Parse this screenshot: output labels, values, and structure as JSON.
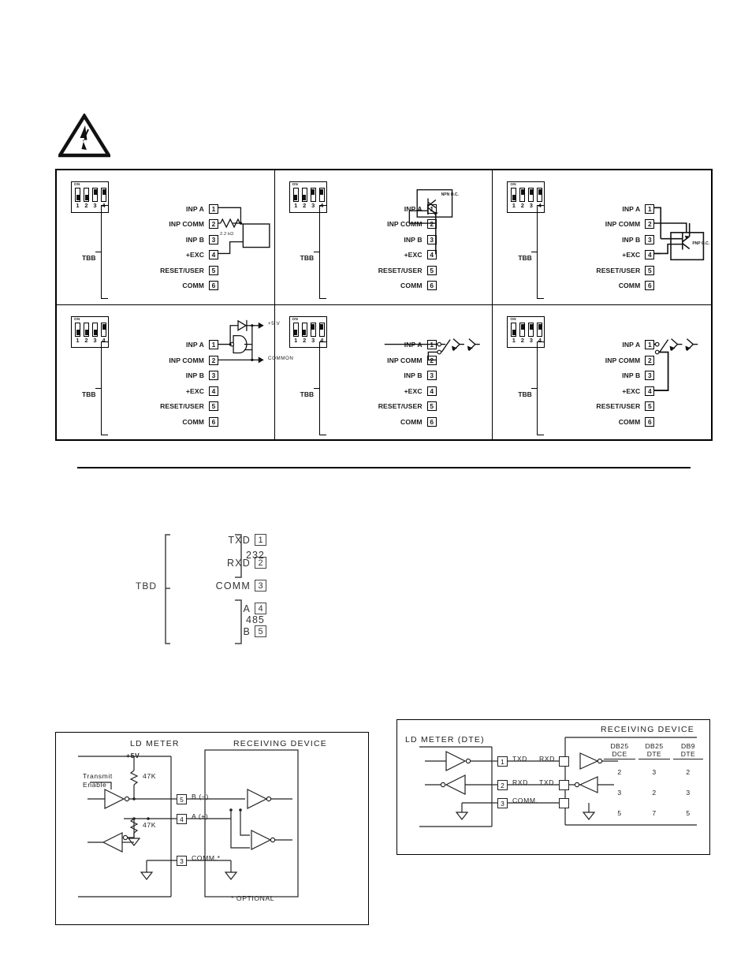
{
  "warning": {
    "icon": "electrical-hazard-triangle-icon"
  },
  "input_grid": {
    "terminal_block_label": "TBB",
    "dip_on_label": "ON",
    "dip_numbers": [
      "1",
      "2",
      "3",
      "4"
    ],
    "terminals": [
      {
        "name": "INP A",
        "num": "1"
      },
      {
        "name": "INP COMM",
        "num": "2"
      },
      {
        "name": "INP B",
        "num": "3"
      },
      {
        "name": "+EXC",
        "num": "4"
      },
      {
        "name": "RESET/USER",
        "num": "5"
      },
      {
        "name": "COMM",
        "num": "6"
      }
    ],
    "panels": [
      {
        "id": "panel-resistor-contact",
        "dip_states": [
          "down",
          "down",
          "up",
          "up"
        ],
        "component_label": "2.2 kΩ",
        "device_label": ""
      },
      {
        "id": "panel-npn-oc",
        "dip_states": [
          "down",
          "down",
          "up",
          "up"
        ],
        "component_label": "",
        "device_label": "NPN O.C."
      },
      {
        "id": "panel-pnp-oc",
        "dip_states": [
          "down",
          "up",
          "up",
          "up"
        ],
        "component_label": "",
        "device_label": "PNP O.C."
      },
      {
        "id": "panel-logic-gate",
        "dip_states": [
          "down",
          "down",
          "down",
          "up"
        ],
        "component_label": "",
        "device_label": "",
        "supply_label": "+5 V",
        "common_label": "COMMON"
      },
      {
        "id": "panel-switch-contacts",
        "dip_states": [
          "down",
          "down",
          "up",
          "up"
        ],
        "component_label": "",
        "device_label": ""
      },
      {
        "id": "panel-switch-exc",
        "dip_states": [
          "down",
          "up",
          "up",
          "up"
        ],
        "component_label": "",
        "device_label": ""
      }
    ]
  },
  "tbd_connector": {
    "label": "TBD",
    "rows": [
      {
        "name": "TXD",
        "num": "1"
      },
      {
        "name": "RXD",
        "num": "2"
      },
      {
        "name": "COMM",
        "num": "3"
      },
      {
        "name": "A",
        "num": "4"
      },
      {
        "name": "B",
        "num": "5"
      }
    ],
    "group_232": "232",
    "group_485": "485"
  },
  "figure_485": {
    "meter_title": "LD METER",
    "device_title": "RECEIVING DEVICE",
    "supply": "+5V",
    "resistor_top": "47K",
    "resistor_bottom": "47K",
    "transmit_enable_line1": "Transmit",
    "transmit_enable_line2": "Enable",
    "pins": [
      {
        "num": "5",
        "name": "B  (−)"
      },
      {
        "num": "4",
        "name": "A  (+)"
      },
      {
        "num": "3",
        "name": "COMM.*"
      }
    ],
    "footnote": "* OPTIONAL"
  },
  "figure_232": {
    "meter_title": "LD METER  (DTE)",
    "device_title": "RECEIVING DEVICE",
    "rows": [
      {
        "pin": "1",
        "meter_signal": "TXD",
        "device_signal": "RXD"
      },
      {
        "pin": "2",
        "meter_signal": "RXD",
        "device_signal": "TXD"
      },
      {
        "pin": "3",
        "meter_signal": "COMM.",
        "device_signal": ""
      }
    ],
    "columns": [
      {
        "head1": "DB25",
        "head2": "DCE",
        "values": [
          "2",
          "3",
          "5"
        ]
      },
      {
        "head1": "DB25",
        "head2": "DTE",
        "values": [
          "3",
          "2",
          "7"
        ]
      },
      {
        "head1": "DB9",
        "head2": "DTE",
        "values": [
          "2",
          "3",
          "5"
        ]
      }
    ]
  }
}
